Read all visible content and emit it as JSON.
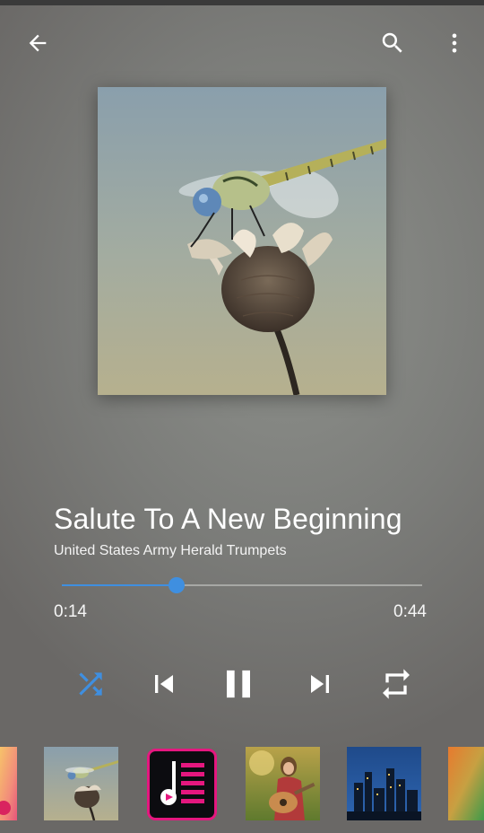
{
  "toolbar": {
    "back_icon": "arrow-left-icon",
    "search_icon": "search-icon",
    "menu_icon": "more-vertical-icon"
  },
  "now_playing": {
    "title": "Salute To A New Beginning",
    "artist": "United States Army Herald Trumpets",
    "artwork": "dragonfly-on-dried-flower"
  },
  "progress": {
    "elapsed": "0:14",
    "total": "0:44",
    "fraction": 0.318
  },
  "controls": {
    "shuffle": {
      "icon": "shuffle-icon",
      "active": true
    },
    "previous": {
      "icon": "skip-previous-icon"
    },
    "play_pause": {
      "icon": "pause-icon",
      "state": "playing"
    },
    "next": {
      "icon": "skip-next-icon"
    },
    "repeat": {
      "icon": "repeat-icon",
      "active": false
    }
  },
  "queue": [
    {
      "artwork": "orange-pink-abstract"
    },
    {
      "artwork": "dragonfly-on-dried-flower",
      "current": true
    },
    {
      "artwork": "music-app-icon"
    },
    {
      "artwork": "girl-with-guitar"
    },
    {
      "artwork": "city-skyline-night"
    },
    {
      "artwork": "green-orange-gradient"
    }
  ],
  "colors": {
    "accent": "#3f8fe0",
    "text": "#ffffff",
    "app_icon_pink": "#e5177f"
  }
}
